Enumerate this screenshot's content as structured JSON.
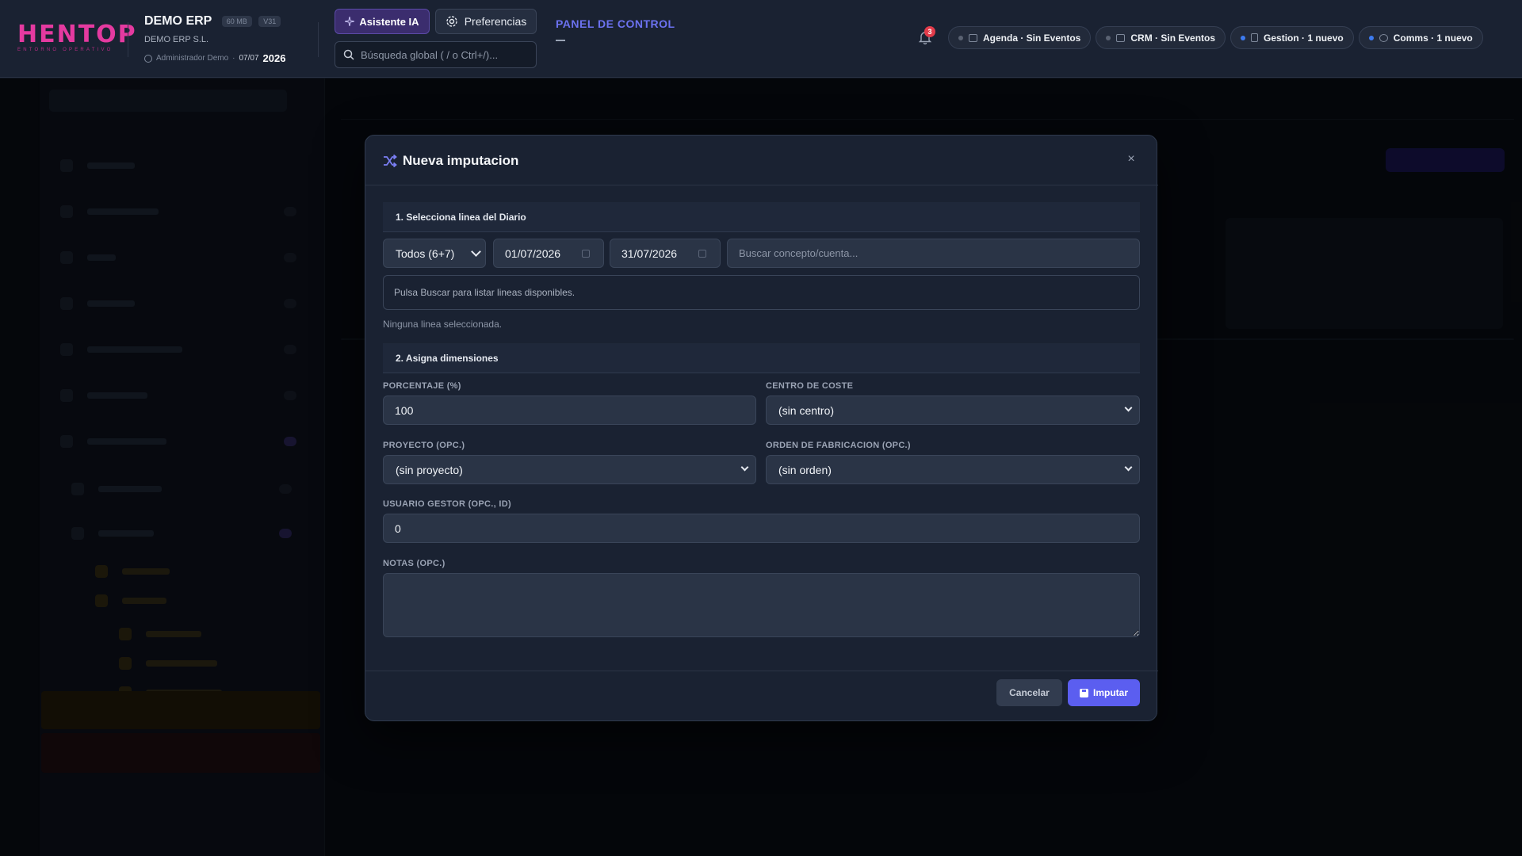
{
  "header": {
    "logo_text": "HENTOP",
    "logo_tagline": "ENTORNO OPERATIVO",
    "company_name": "DEMO ERP",
    "size_badge": "60 MB",
    "version_badge": "V31",
    "legal_name": "DEMO ERP S.L.",
    "user_name": "Administrador Demo",
    "separator": "·",
    "date_short": "07/07",
    "year": "2026",
    "ai_button": "Asistente IA",
    "prefs_button": "Preferencias",
    "search_placeholder": "Búsqueda global ( / o Ctrl+/)...",
    "panel_title": "PANEL DE CONTROL",
    "notification_count": "3",
    "chips": [
      {
        "label": "Agenda · Sin Eventos",
        "status": "gray"
      },
      {
        "label": "CRM · Sin Eventos",
        "status": "gray"
      },
      {
        "label": "Gestion · 1 nuevo",
        "status": "blue"
      },
      {
        "label": "Comms · 1 nuevo",
        "status": "blue"
      }
    ]
  },
  "modal": {
    "title": "Nueva imputacion",
    "close_label": "×",
    "section1": "1. Selecciona linea del Diario",
    "filter_options": [
      "Todos (6+7)"
    ],
    "filter_selected": "Todos (6+7)",
    "date_from": "01/07/2026",
    "date_to": "31/07/2026",
    "search_placeholder": "Buscar concepto/cuenta...",
    "info_message": "Pulsa Buscar para listar lineas disponibles.",
    "selection_note": "Ninguna linea seleccionada.",
    "section2": "2. Asigna dimensiones",
    "percentage_label": "PORCENTAJE (%)",
    "percentage_value": "100",
    "cost_center_label": "CENTRO DE COSTE",
    "cost_center_value": "(sin centro)",
    "project_label": "PROYECTO (OPC.)",
    "project_value": "(sin proyecto)",
    "order_label": "ORDEN DE FABRICACION (OPC.)",
    "order_value": "(sin orden)",
    "manager_label": "USUARIO GESTOR (OPC., ID)",
    "manager_value": "0",
    "notes_label": "NOTAS (OPC.)",
    "notes_value": "",
    "cancel_button": "Cancelar",
    "submit_button": "Imputar"
  },
  "colors": {
    "accent": "#5b5ef0",
    "brand": "#e53aa0",
    "panel_title": "#6c72f0",
    "badge": "#e23b4a"
  }
}
